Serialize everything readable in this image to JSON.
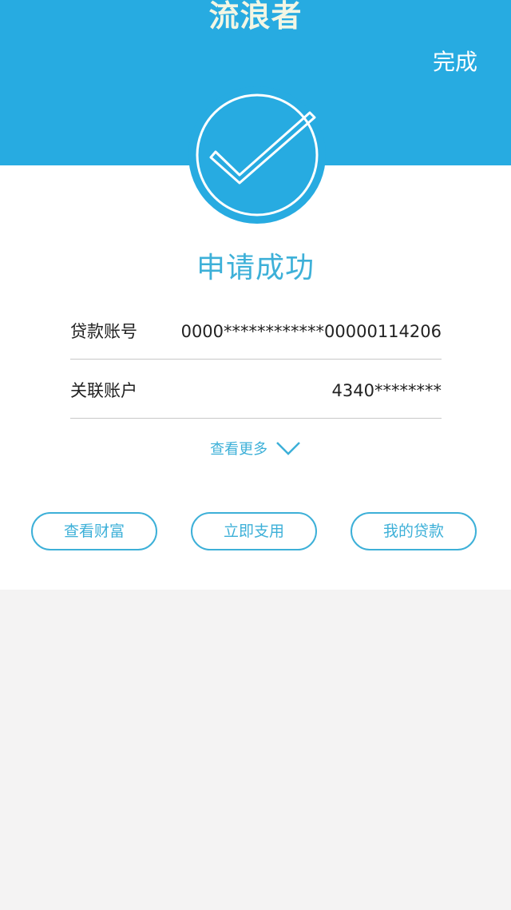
{
  "watermark": "流浪者",
  "header": {
    "done_label": "完成"
  },
  "status": {
    "title": "申请成功"
  },
  "details": [
    {
      "label": "贷款账号",
      "value": "0000************00000114206"
    },
    {
      "label": "关联账户",
      "value": "4340********"
    }
  ],
  "more": {
    "label": "查看更多"
  },
  "actions": [
    {
      "label": "查看财富"
    },
    {
      "label": "立即支用"
    },
    {
      "label": "我的贷款"
    }
  ],
  "colors": {
    "header_bg": "#27abe1",
    "accent": "#3db0d8",
    "page_bg": "#f4f3f3",
    "card_bg": "#ffffff"
  },
  "icons": {
    "success": "checkmark-circle-icon",
    "expand": "chevron-down-icon"
  }
}
